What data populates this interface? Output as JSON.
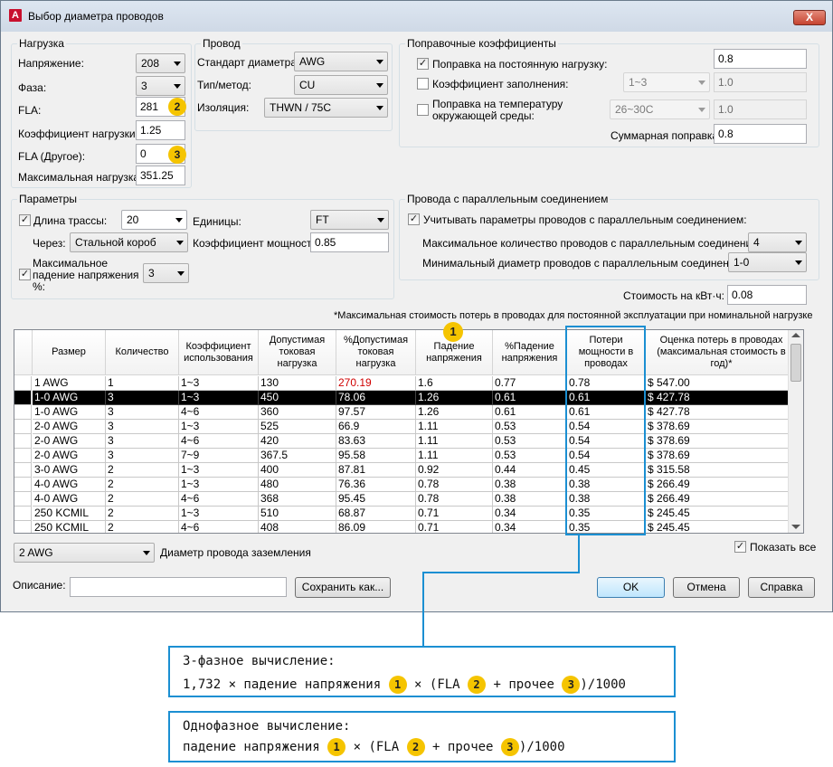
{
  "window": {
    "title": "Выбор диаметра проводов",
    "close_label": "X"
  },
  "load": {
    "legend": "Нагрузка",
    "voltage_label": "Напряжение:",
    "voltage_value": "208",
    "phase_label": "Фаза:",
    "phase_value": "3",
    "fla_label": "FLA:",
    "fla_value": "281",
    "load_factor_label": "Коэффициент нагрузки:",
    "load_factor_value": "1.25",
    "fla_other_label": "FLA (Другое):",
    "fla_other_value": "0",
    "max_load_label": "Максимальная нагрузка:",
    "max_load_value": "351.25"
  },
  "wire": {
    "legend": "Провод",
    "standard_label": "Стандарт диаметра:",
    "standard_value": "AWG",
    "type_label": "Тип/метод:",
    "type_value": "CU",
    "insulation_label": "Изоляция:",
    "insulation_value": "THWN / 75C"
  },
  "correction": {
    "legend": "Поправочные коэффициенты",
    "continuous_label": "Поправка на постоянную нагрузку:",
    "continuous_value": "0.8",
    "fill_label": "Коэффициент заполнения:",
    "fill_select": "1~3",
    "fill_value": "1.0",
    "ambient_label_1": "Поправка на температуру",
    "ambient_label_2": "окружающей среды:",
    "ambient_select": "26~30C",
    "ambient_value": "1.0",
    "total_label": "Суммарная поправка:",
    "total_value": "0.8"
  },
  "params": {
    "legend": "Параметры",
    "run_length_label": "Длина трассы:",
    "run_length_value": "20",
    "units_label": "Единицы:",
    "units_value": "FT",
    "through_label": "Через:",
    "through_value": "Стальной короб",
    "power_factor_label": "Коэффициент мощности:",
    "power_factor_value": "0.85",
    "max_drop_label_1": "Максимальное",
    "max_drop_label_2": "падение напряжения",
    "max_drop_label_3": "%:",
    "max_drop_value": "3"
  },
  "parallel": {
    "legend": "Провода с параллельным соединением",
    "consider_label": "Учитывать параметры проводов с параллельным соединением:",
    "max_count_label": "Максимальное количество проводов с параллельным соединением:",
    "max_count_value": "4",
    "min_diam_label": "Минимальный диаметр проводов с параллельным соединением:",
    "min_diam_value": "1-0"
  },
  "cost": {
    "label": "Стоимость на кВт·ч:",
    "value": "0.08"
  },
  "note": "*Максимальная стоимость потерь в проводах для постоянной эксплуатации при номинальной нагрузке",
  "table": {
    "headers": [
      "Размер",
      "Количество",
      "Коэффициент использования",
      "Допустимая токовая нагрузка",
      "%Допустимая токовая нагрузка",
      "Падение напряжения",
      "%Падение напряжения",
      "Потери мощности в проводах",
      "Оценка потерь в проводах (максимальная стоимость в год)*"
    ],
    "rows": [
      [
        "1 AWG",
        "1",
        "1~3",
        "130",
        "270.19",
        "1.6",
        "0.77",
        "0.78",
        "$ 547.00"
      ],
      [
        "1-0 AWG",
        "3",
        "1~3",
        "450",
        "78.06",
        "1.26",
        "0.61",
        "0.61",
        "$ 427.78"
      ],
      [
        "1-0 AWG",
        "3",
        "4~6",
        "360",
        "97.57",
        "1.26",
        "0.61",
        "0.61",
        "$ 427.78"
      ],
      [
        "2-0 AWG",
        "3",
        "1~3",
        "525",
        "66.9",
        "1.11",
        "0.53",
        "0.54",
        "$ 378.69"
      ],
      [
        "2-0 AWG",
        "3",
        "4~6",
        "420",
        "83.63",
        "1.11",
        "0.53",
        "0.54",
        "$ 378.69"
      ],
      [
        "2-0 AWG",
        "3",
        "7~9",
        "367.5",
        "95.58",
        "1.11",
        "0.53",
        "0.54",
        "$ 378.69"
      ],
      [
        "3-0 AWG",
        "2",
        "1~3",
        "400",
        "87.81",
        "0.92",
        "0.44",
        "0.45",
        "$ 315.58"
      ],
      [
        "4-0 AWG",
        "2",
        "1~3",
        "480",
        "76.36",
        "0.78",
        "0.38",
        "0.38",
        "$ 266.49"
      ],
      [
        "4-0 AWG",
        "2",
        "4~6",
        "368",
        "95.45",
        "0.78",
        "0.38",
        "0.38",
        "$ 266.49"
      ],
      [
        "250 KCMIL",
        "2",
        "1~3",
        "510",
        "68.87",
        "0.71",
        "0.34",
        "0.35",
        "$ 245.45"
      ],
      [
        "250 KCMIL",
        "2",
        "4~6",
        "408",
        "86.09",
        "0.71",
        "0.34",
        "0.35",
        "$ 245.45"
      ]
    ],
    "selected_row": 1,
    "warning_color": "#d00000"
  },
  "ground": {
    "value": "2 AWG",
    "label": "Диаметр провода заземления"
  },
  "show_all_label": "Показать все",
  "description_label": "Описание:",
  "description_value": "",
  "buttons": {
    "save_as": "Сохранить как...",
    "ok": "OK",
    "cancel": "Отмена",
    "help": "Справка"
  },
  "badges": {
    "one": "1",
    "two": "2",
    "three": "3"
  },
  "formula3": {
    "title": "3-фазное вычисление:",
    "part1": "1,732 × падение напряжения",
    "part2": "× (FLA",
    "part3": "+ прочее",
    "part4": ")/1000"
  },
  "formula1": {
    "title": "Однофазное вычисление:",
    "part1": "падение напряжения",
    "part2": "× (FLA",
    "part3": "+ прочее",
    "part4": ")/1000"
  },
  "colors": {
    "accent": "#1b8fd2",
    "badge": "#f5c400"
  }
}
